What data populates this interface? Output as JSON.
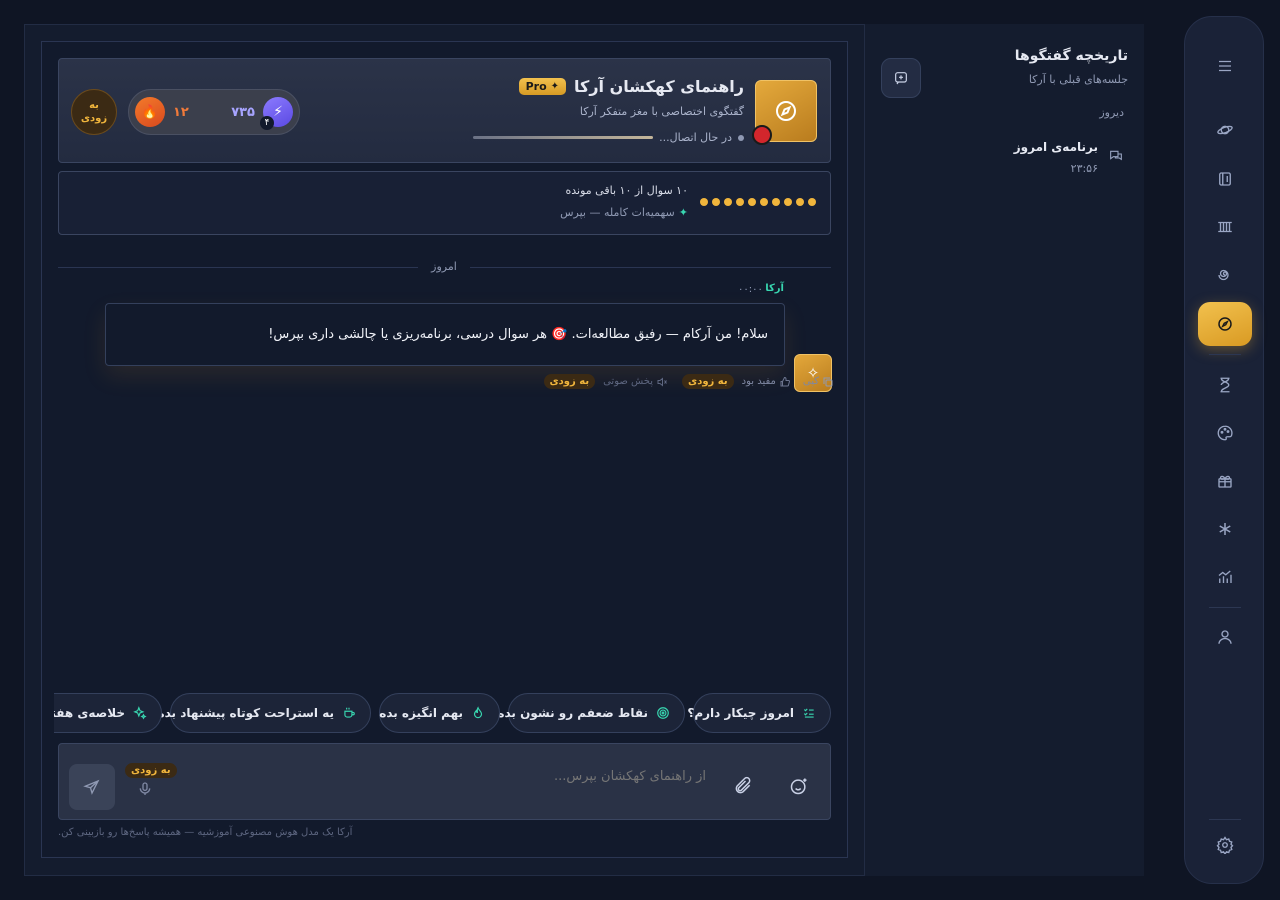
{
  "sidebar": {
    "rail_icons": [
      "menu-icon",
      "planet-icon",
      "book-icon",
      "columns-icon",
      "spiral-icon",
      "compass-icon",
      "hourglass-icon",
      "palette-icon",
      "gift-icon",
      "sparkle-asterisk-icon",
      "stats-icon",
      "user-icon",
      "settings-icon"
    ],
    "active_color": "#f0b53c"
  },
  "history": {
    "title": "تاریخچه گفتگوها",
    "subtitle": "جلسه‌های قبلی با آرکا",
    "group_label": "دیروز",
    "items": [
      {
        "title": "برنامه‌ی امروز",
        "time": "۲۳:۵۶"
      }
    ]
  },
  "header": {
    "title": "راهنمای کهکشان آرکا",
    "pro_badge": "Pro",
    "subtitle": "گفتگوی اختصاصی با مغز متفکر آرکا",
    "status": "در حال اتصال...",
    "xp_value": "۷۳۵",
    "level": "۴",
    "streak_value": "۱۲",
    "soon_badge": "به زودی"
  },
  "quota": {
    "text": "۱۰ سوال از ۱۰ باقی مونده",
    "sub": "سهمیه‌ات کامله — بپرس",
    "dots": 10
  },
  "chat": {
    "date_divider": "امروز",
    "sender": "آرکا",
    "time": "۰۰:۰۰",
    "message": "سلام! من آرکام — رفیق مطالعه‌ات. 🎯 هر سوال درسی، برنامه‌ریزی یا چالشی داری بپرس!",
    "actions": {
      "copy": "کپی",
      "helpful": "مفید بود",
      "audio": "پخش صوتی",
      "soon1": "به زودی",
      "soon2": "به زودی"
    }
  },
  "suggestions": [
    "امروز چیکار دارم؟",
    "نقاط ضعفم رو نشون بده",
    "بهم انگیزه بده",
    "یه استراحت کوتاه پیشنهاد بده",
    "خلاصه‌ی هفته"
  ],
  "composer": {
    "placeholder": "از راهنمای کهکشان بپرس...",
    "mic_soon": "به زودی",
    "disclaimer": "آرکا یک مدل هوش مصنوعی آموزشیه — همیشه پاسخ‌ها رو بازبینی کن."
  }
}
